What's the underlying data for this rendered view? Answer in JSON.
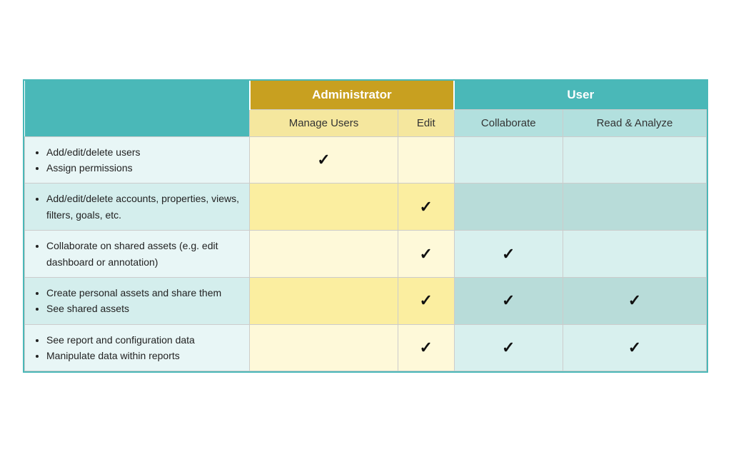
{
  "table": {
    "header1": {
      "empty_label": "",
      "admin_label": "Administrator",
      "user_label": "User"
    },
    "header2": {
      "manage_users": "Manage Users",
      "edit": "Edit",
      "collaborate": "Collaborate",
      "read_analyze": "Read & Analyze"
    },
    "rows": [
      {
        "id": "row1",
        "bg": "light",
        "features": [
          "Add/edit/delete users",
          "Assign permissions"
        ],
        "manage_check": true,
        "edit_check": false,
        "collaborate_check": false,
        "read_analyze_check": false
      },
      {
        "id": "row2",
        "bg": "yellow",
        "features": [
          "Add/edit/delete accounts, properties, views, filters, goals, etc."
        ],
        "manage_check": false,
        "edit_check": true,
        "collaborate_check": false,
        "read_analyze_check": false
      },
      {
        "id": "row3",
        "bg": "light",
        "features": [
          "Collaborate on shared assets (e.g. edit dashboard or annotation)"
        ],
        "manage_check": false,
        "edit_check": true,
        "collaborate_check": true,
        "read_analyze_check": false
      },
      {
        "id": "row4",
        "bg": "yellow",
        "features": [
          "Create personal assets and share them",
          "See shared assets"
        ],
        "manage_check": false,
        "edit_check": true,
        "collaborate_check": true,
        "read_analyze_check": true
      },
      {
        "id": "row5",
        "bg": "light",
        "features": [
          "See report and configuration data",
          "Manipulate data within reports"
        ],
        "manage_check": false,
        "edit_check": true,
        "collaborate_check": true,
        "read_analyze_check": true
      }
    ]
  }
}
